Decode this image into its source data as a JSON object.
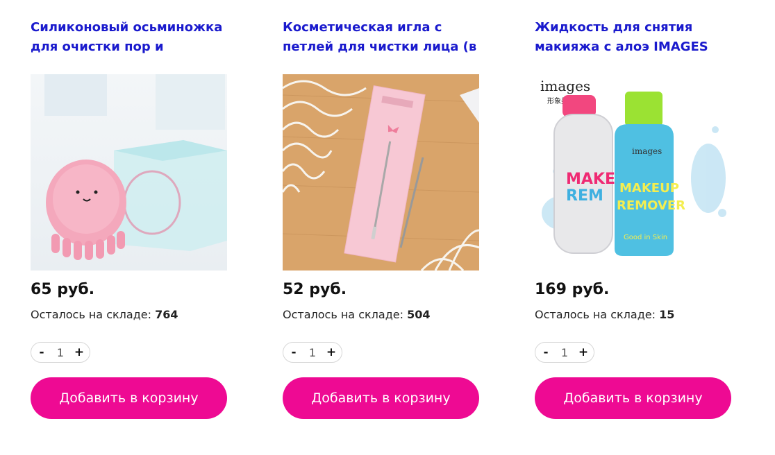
{
  "colors": {
    "title": "#1a1acd",
    "button": "#ee0a93",
    "button_text": "#ffffff"
  },
  "products": [
    {
      "title": "Силиконовый осьминожка для очистки пор и",
      "price": "65 руб.",
      "stock_label": "Осталось на складе:",
      "stock_value": "764",
      "quantity": "1",
      "minus": "-",
      "plus": "+",
      "button": "Добавить в корзину",
      "image_icon": "octopus-sponge-image"
    },
    {
      "title": "Косметическая игла с петлей для чистки лица (в",
      "price": "52 руб.",
      "stock_label": "Осталось на складе:",
      "stock_value": "504",
      "quantity": "1",
      "minus": "-",
      "plus": "+",
      "button": "Добавить в корзину",
      "image_icon": "cosmetic-needle-image"
    },
    {
      "title": "Жидкость для снятия макияжа с алоэ IMAGES",
      "price": "169 руб.",
      "stock_label": "Осталось на складе:",
      "stock_value": "15",
      "quantity": "1",
      "minus": "-",
      "plus": "+",
      "button": "Добавить в корзину",
      "image_icon": "makeup-remover-image",
      "image_text": {
        "brand": "images",
        "brand_cn": "形象美",
        "bottle_brand": "images",
        "line1": "MAKEUP",
        "line2": "REMOVER",
        "side1": "MAKE",
        "side2": "REM",
        "tag": "Good in Skin"
      }
    }
  ]
}
